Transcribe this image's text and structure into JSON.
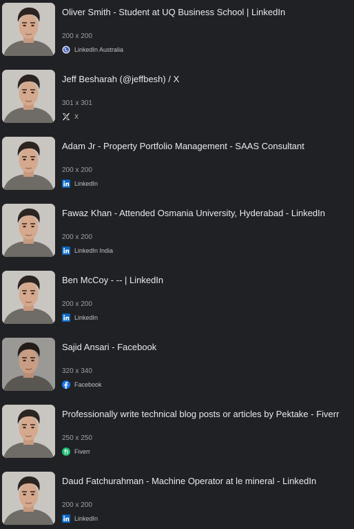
{
  "results": [
    {
      "title": "Oliver Smith - Student at UQ Business School | LinkedIn",
      "dimensions": "200 x 200",
      "source": "LinkedIn Australia",
      "source_icon": "globe-icon",
      "thumbnail": "portrait-thumbnail"
    },
    {
      "title": "Jeff Besharah (@jeffbesh) / X",
      "dimensions": "301 x 301",
      "source": "X",
      "source_icon": "x-logo-icon",
      "thumbnail": "portrait-thumbnail"
    },
    {
      "title": "Adam Jr - Property Portfolio Management - SAAS Consultant",
      "dimensions": "200 x 200",
      "source": "LinkedIn",
      "source_icon": "linkedin-icon",
      "thumbnail": "portrait-thumbnail"
    },
    {
      "title": "Fawaz Khan - Attended Osmania University, Hyderabad - LinkedIn",
      "dimensions": "200 x 200",
      "source": "LinkedIn India",
      "source_icon": "linkedin-icon",
      "thumbnail": "portrait-thumbnail"
    },
    {
      "title": "Ben McCoy - -- | LinkedIn",
      "dimensions": "200 x 200",
      "source": "LinkedIn",
      "source_icon": "linkedin-icon",
      "thumbnail": "portrait-thumbnail"
    },
    {
      "title": "Sajid Ansari - Facebook",
      "dimensions": "320 x 340",
      "source": "Facebook",
      "source_icon": "facebook-icon",
      "thumbnail": "portrait-thumbnail"
    },
    {
      "title": "Professionally write technical blog posts or articles by Pektake - Fiverr",
      "dimensions": "250 x 250",
      "source": "Fiverr",
      "source_icon": "fiverr-icon",
      "thumbnail": "portrait-thumbnail"
    },
    {
      "title": "Daud Fatchurahman - Machine Operator at le mineral - LinkedIn",
      "dimensions": "200 x 200",
      "source": "LinkedIn",
      "source_icon": "linkedin-icon",
      "thumbnail": "portrait-thumbnail"
    }
  ],
  "colors": {
    "background": "#202124",
    "title_text": "#e8eaed",
    "meta_text": "#9aa0a6",
    "linkedin_blue": "#0a66c2",
    "facebook_blue": "#1877f2",
    "fiverr_green": "#1dbf73"
  }
}
